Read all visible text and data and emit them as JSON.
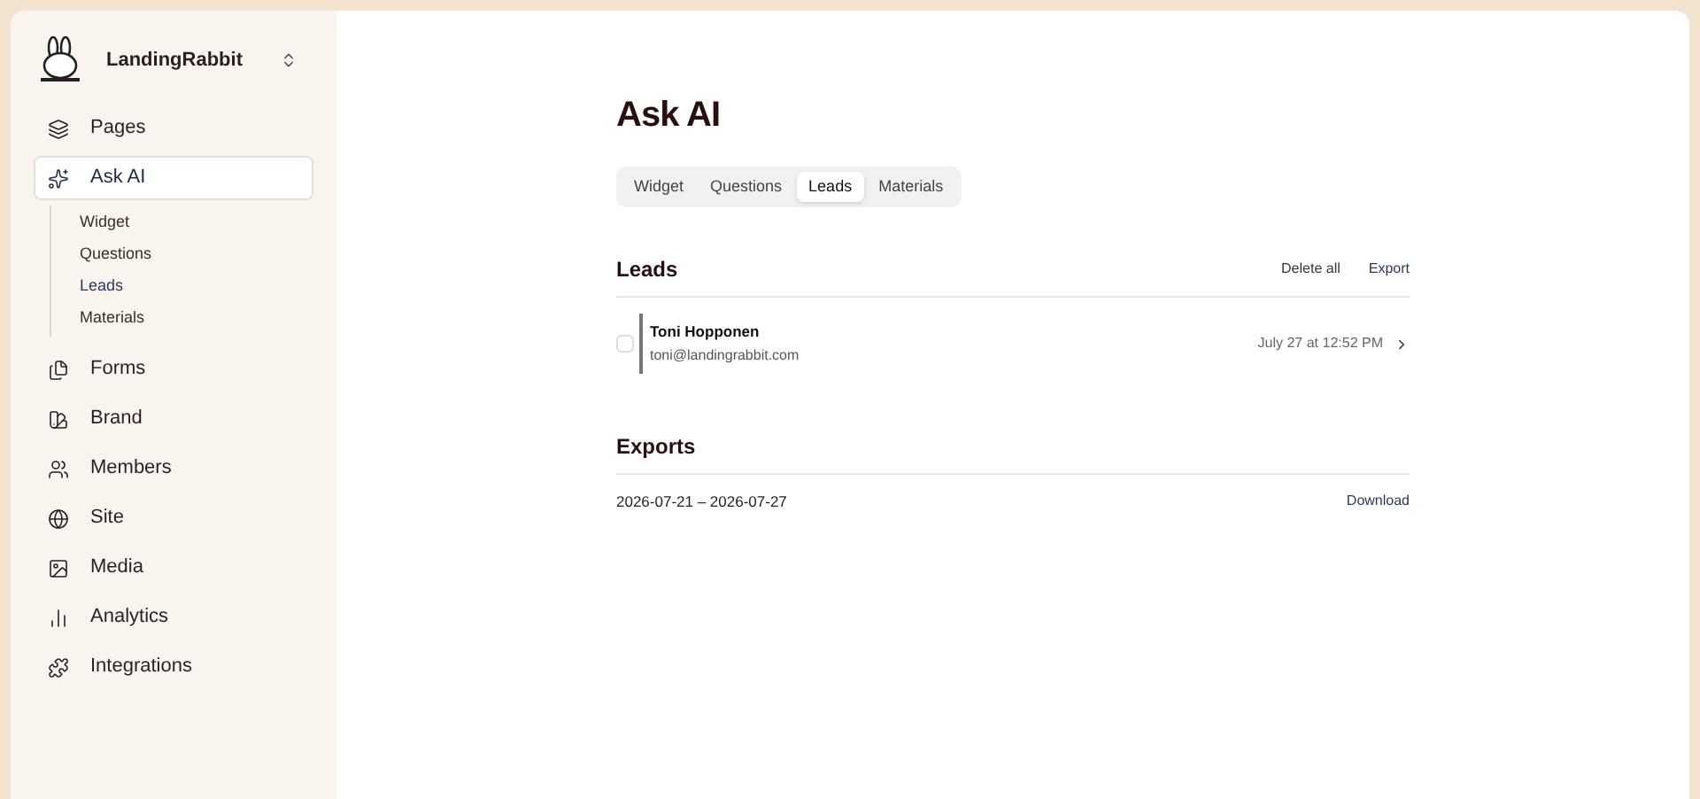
{
  "workspace": {
    "name": "LandingRabbit"
  },
  "sidebar": {
    "items": [
      {
        "label": "Pages",
        "selected": false
      },
      {
        "label": "Ask AI",
        "selected": true,
        "expanded": true,
        "children": [
          {
            "label": "Widget",
            "selected": false
          },
          {
            "label": "Questions",
            "selected": false
          },
          {
            "label": "Leads",
            "selected": true
          },
          {
            "label": "Materials",
            "selected": false
          }
        ]
      },
      {
        "label": "Forms",
        "selected": false
      },
      {
        "label": "Brand",
        "selected": false
      },
      {
        "label": "Members",
        "selected": false
      },
      {
        "label": "Site",
        "selected": false
      },
      {
        "label": "Media",
        "selected": false
      },
      {
        "label": "Analytics",
        "selected": false
      },
      {
        "label": "Integrations",
        "selected": false
      }
    ]
  },
  "page": {
    "title": "Ask AI"
  },
  "tabs": [
    {
      "label": "Widget",
      "selected": false
    },
    {
      "label": "Questions",
      "selected": false
    },
    {
      "label": "Leads",
      "selected": true
    },
    {
      "label": "Materials",
      "selected": false
    }
  ],
  "leads": {
    "title": "Leads",
    "actions": [
      "Delete all",
      "Export"
    ],
    "rows": [
      {
        "name": "Toni Hopponen",
        "email": "toni@landingrabbit.com",
        "date": "July 27 at 12:52 PM",
        "checked": false
      }
    ]
  },
  "exports": {
    "title": "Exports",
    "rows": [
      {
        "range": "2026-07-21 – 2026-07-27",
        "action": "Download"
      }
    ]
  }
}
